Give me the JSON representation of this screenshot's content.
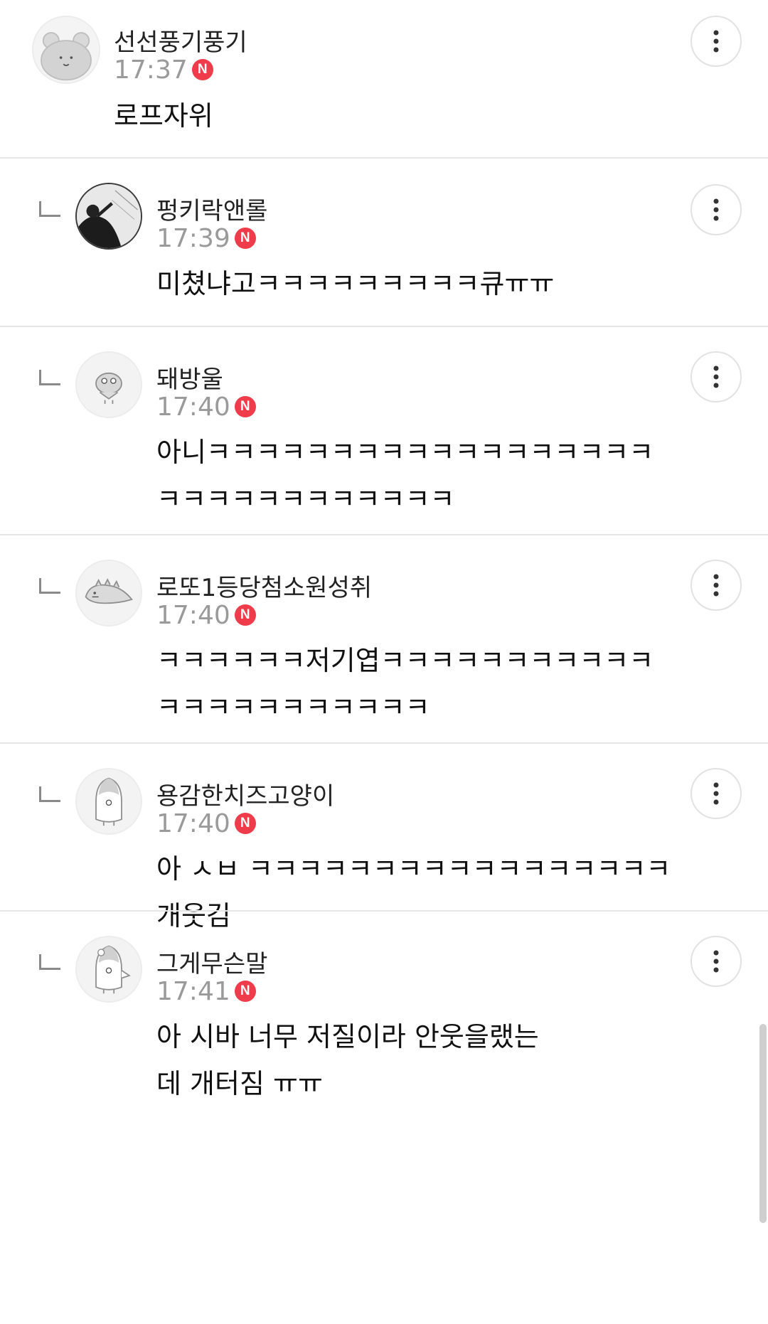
{
  "comments": [
    {
      "nickname": "선선풍기풍기",
      "time": "17:37",
      "badge": "N",
      "text": "로프자위",
      "is_reply": false,
      "avatar_icon": "bear-icon"
    },
    {
      "nickname": "펑키락앤롤",
      "time": "17:39",
      "badge": "N",
      "text": "미쳤냐고ㅋㅋㅋㅋㅋㅋㅋㅋㅋ큐ㅠㅠ",
      "is_reply": true,
      "avatar_icon": "photo-avatar-icon"
    },
    {
      "nickname": "돼방울",
      "time": "17:40",
      "badge": "N",
      "text": "아니ㅋㅋㅋㅋㅋㅋㅋㅋㅋㅋㅋㅋㅋㅋㅋㅋㅋㅋㅋㅋㅋㅋㅋㅋㅋㅋㅋㅋㅋㅋ",
      "is_reply": true,
      "avatar_icon": "bird-icon"
    },
    {
      "nickname": "로또1등당첨소원성취",
      "time": "17:40",
      "badge": "N",
      "text": "ㅋㅋㅋㅋㅋㅋ저기엽ㅋㅋㅋㅋㅋㅋㅋㅋㅋㅋㅋㅋㅋㅋㅋㅋㅋㅋㅋㅋㅋㅋ",
      "is_reply": true,
      "avatar_icon": "dinosaur-icon"
    },
    {
      "nickname": "용감한치즈고양이",
      "time": "17:40",
      "badge": "N",
      "text": "아 ㅅㅂ ㅋㅋㅋㅋㅋㅋㅋㅋㅋㅋㅋㅋㅋㅋㅋㅋㅋ개웃김",
      "is_reply": true,
      "avatar_icon": "penguin-icon"
    },
    {
      "nickname": "그게무슨말",
      "time": "17:41",
      "badge": "N",
      "text": "아 시바 너무 저질이라 안웃을랬는데 개터짐 ㅠㅠ",
      "is_reply": true,
      "avatar_icon": "penguin-flower-icon"
    }
  ]
}
